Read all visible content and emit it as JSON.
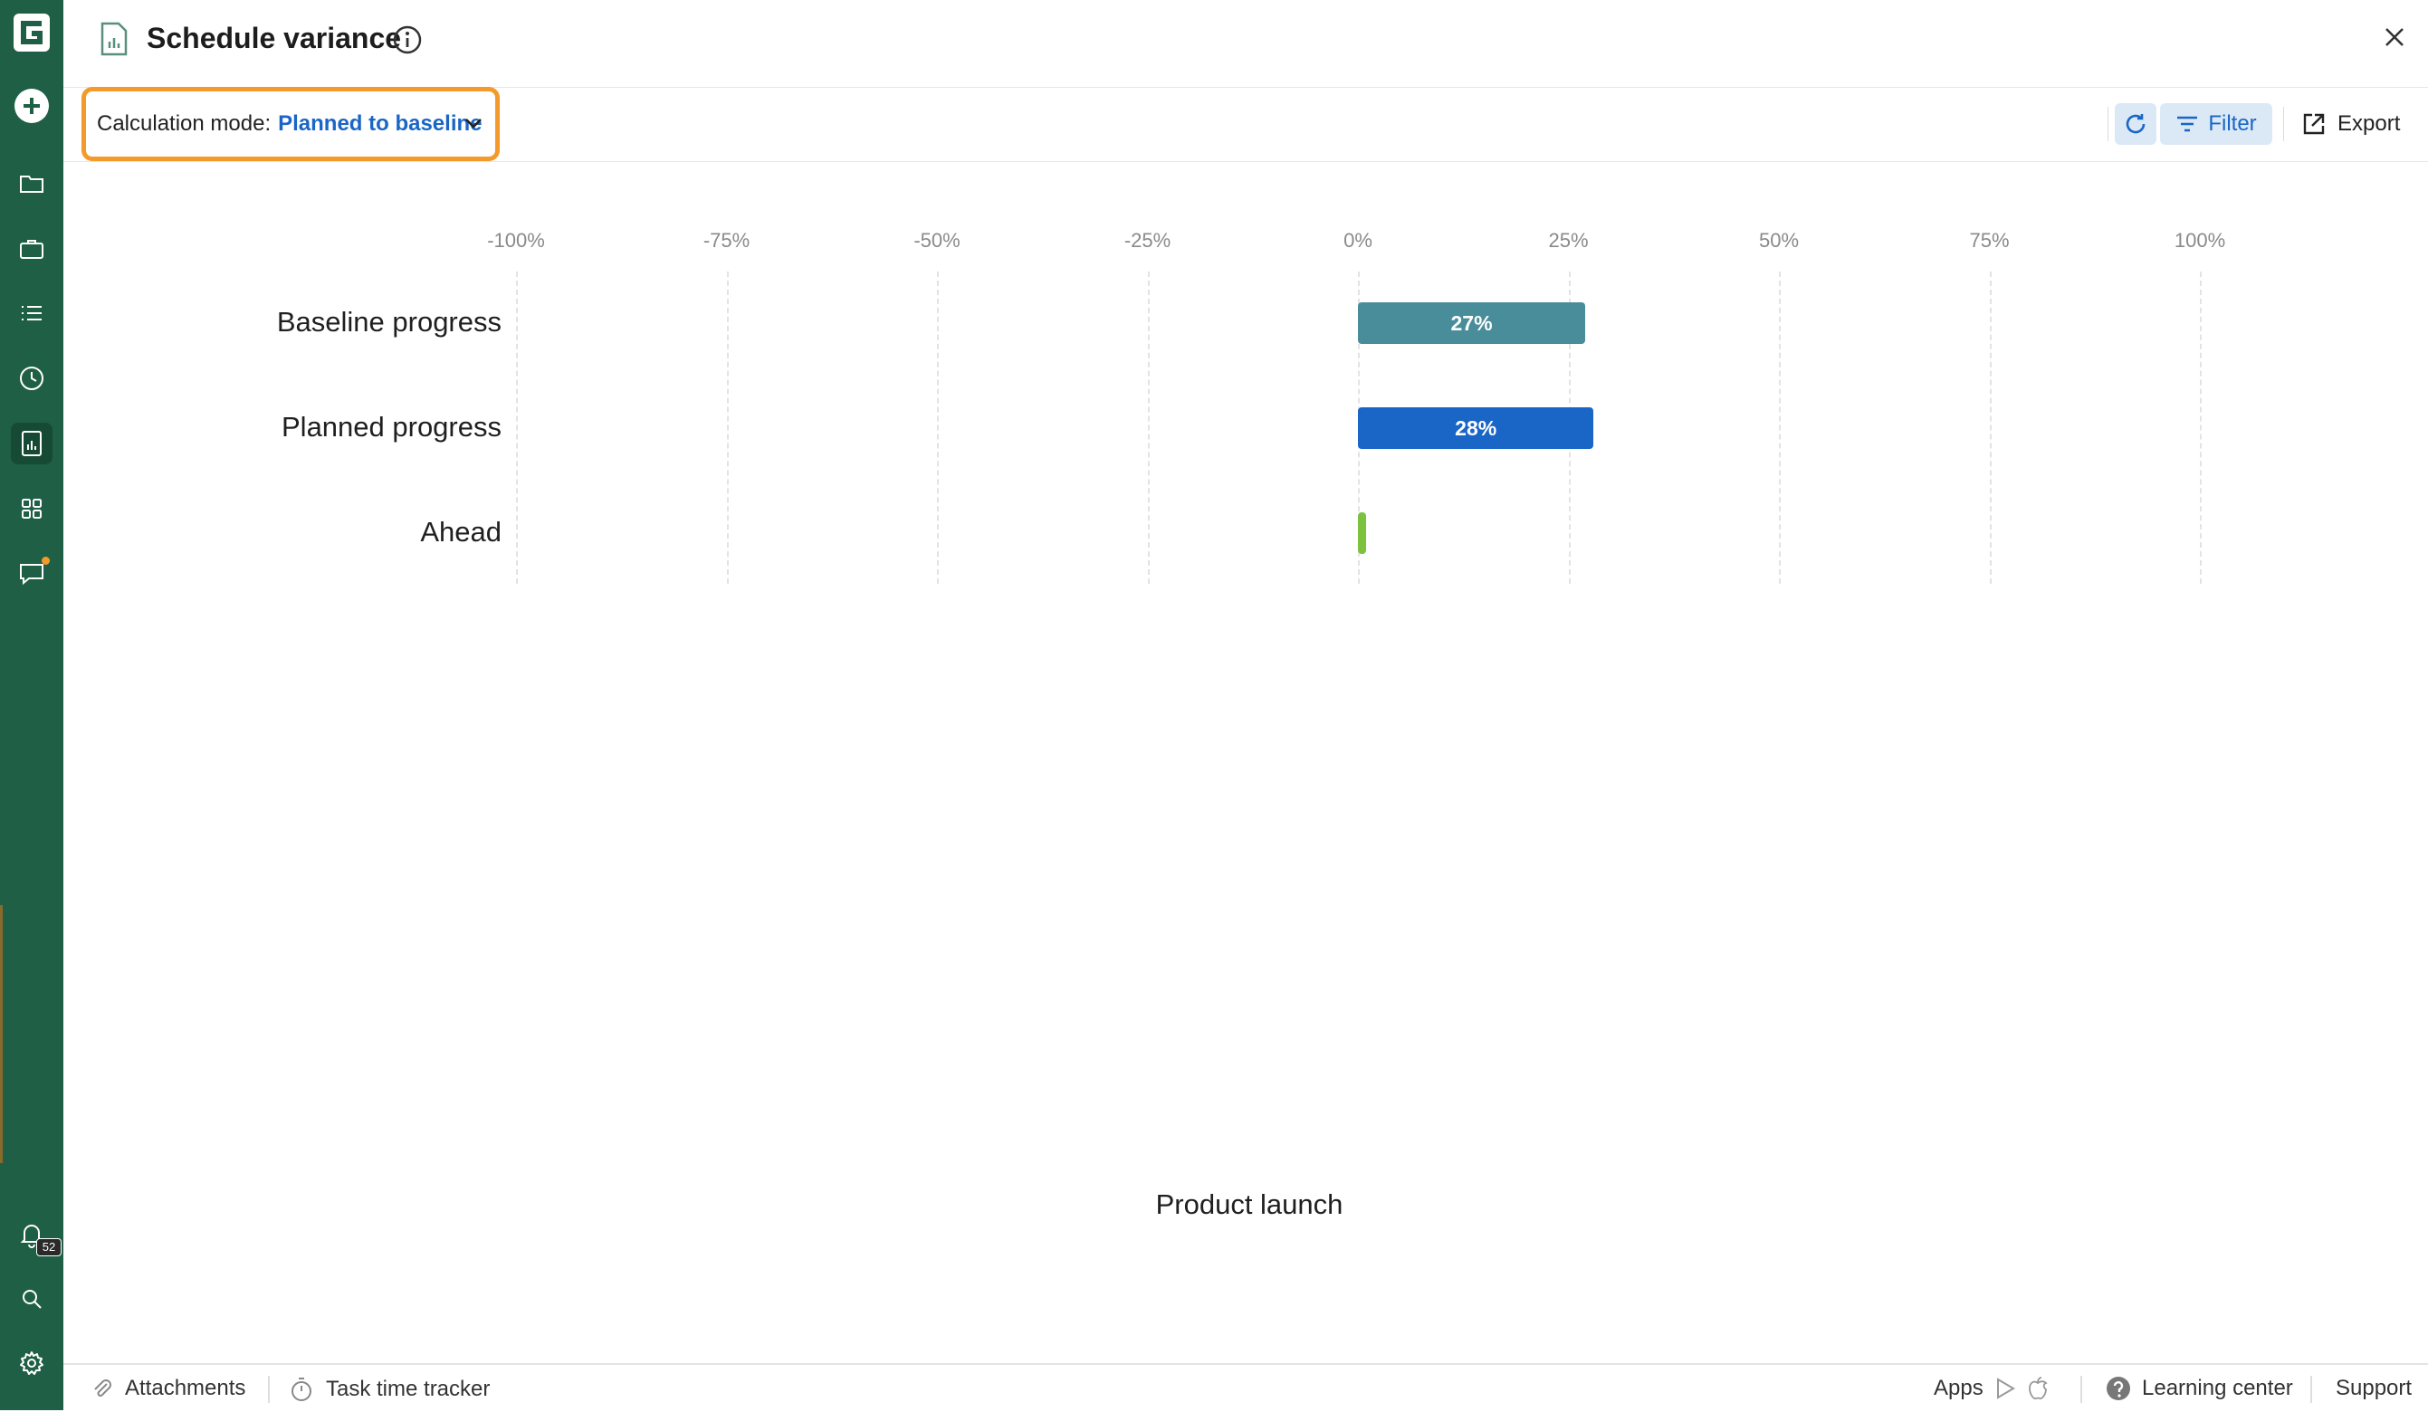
{
  "app": {
    "logo_letter": "G"
  },
  "rail": {
    "items": [
      {
        "icon": "plus-circle-icon"
      },
      {
        "icon": "folder-icon"
      },
      {
        "icon": "briefcase-icon"
      },
      {
        "icon": "list-icon"
      },
      {
        "icon": "clock-icon"
      },
      {
        "icon": "report-icon",
        "active": true
      },
      {
        "icon": "apps-grid-icon"
      },
      {
        "icon": "chat-icon",
        "notification_dot": true
      }
    ],
    "notifications_count": "52"
  },
  "header": {
    "title": "Schedule variance"
  },
  "toolbar": {
    "calc_mode_label": "Calculation mode:",
    "calc_mode_value": "Planned to baseline",
    "filter_label": "Filter",
    "export_label": "Export"
  },
  "colors": {
    "rail": "#1e5f45",
    "accent_orange": "#f39a2b",
    "link_blue": "#1a66c6",
    "baseline_bar": "#4a8d9a",
    "planned_bar": "#1a66c6",
    "ahead_bar": "#7dc23f"
  },
  "chart_data": {
    "type": "bar",
    "orientation": "horizontal",
    "x_ticks": [
      "-100%",
      "-75%",
      "-50%",
      "-25%",
      "0%",
      "25%",
      "50%",
      "75%",
      "100%"
    ],
    "xlim": [
      -100,
      100
    ],
    "categories": [
      "Baseline progress",
      "Planned progress",
      "Ahead"
    ],
    "values": [
      27,
      28,
      1
    ],
    "value_labels": [
      "27%",
      "28%",
      ""
    ],
    "grid": true,
    "xlabel": "Product launch"
  },
  "footer": {
    "attachments": "Attachments",
    "time_tracker": "Task time tracker",
    "apps": "Apps",
    "learning_center": "Learning center",
    "support": "Support"
  }
}
